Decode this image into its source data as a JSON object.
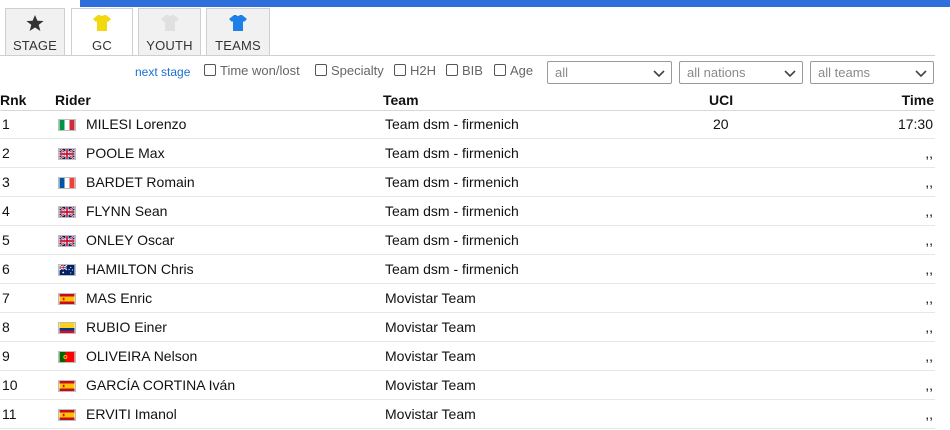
{
  "tabs": [
    {
      "label": "STAGE",
      "icon": "star-icon",
      "active": false
    },
    {
      "label": "GC",
      "icon": "yellow-jersey-icon",
      "active": true
    },
    {
      "label": "YOUTH",
      "icon": "white-jersey-icon",
      "active": false
    },
    {
      "label": "TEAMS",
      "icon": "blue-jersey-icon",
      "active": false
    }
  ],
  "colors": {
    "accent_bar": "#2f6fdc",
    "link": "#1a6fd1",
    "yellow_jersey": "#f2d80f",
    "white_jersey": "#e0e0e0",
    "blue_jersey": "#1f7fe8"
  },
  "filters": {
    "next_stage_label": "next stage",
    "checkboxes": [
      "Time won/lost",
      "Specialty",
      "H2H",
      "BIB",
      "Age"
    ],
    "selects": [
      {
        "value": "all"
      },
      {
        "value": "all nations"
      },
      {
        "value": "all teams"
      }
    ]
  },
  "table": {
    "headers": {
      "rnk": "Rnk",
      "rider": "Rider",
      "team": "Team",
      "uci": "UCI",
      "time": "Time"
    },
    "rows": [
      {
        "rnk": "1",
        "flag": "it",
        "rider": "MILESI Lorenzo",
        "team": "Team dsm - firmenich",
        "uci": "20",
        "time": "17:30"
      },
      {
        "rnk": "2",
        "flag": "gb",
        "rider": "POOLE Max",
        "team": "Team dsm - firmenich",
        "uci": "",
        "time": ",,"
      },
      {
        "rnk": "3",
        "flag": "fr",
        "rider": "BARDET Romain",
        "team": "Team dsm - firmenich",
        "uci": "",
        "time": ",,"
      },
      {
        "rnk": "4",
        "flag": "gb",
        "rider": "FLYNN Sean",
        "team": "Team dsm - firmenich",
        "uci": "",
        "time": ",,"
      },
      {
        "rnk": "5",
        "flag": "gb",
        "rider": "ONLEY Oscar",
        "team": "Team dsm - firmenich",
        "uci": "",
        "time": ",,"
      },
      {
        "rnk": "6",
        "flag": "au",
        "rider": "HAMILTON Chris",
        "team": "Team dsm - firmenich",
        "uci": "",
        "time": ",,"
      },
      {
        "rnk": "7",
        "flag": "es",
        "rider": "MAS Enric",
        "team": "Movistar Team",
        "uci": "",
        "time": ",,"
      },
      {
        "rnk": "8",
        "flag": "co",
        "rider": "RUBIO Einer",
        "team": "Movistar Team",
        "uci": "",
        "time": ",,"
      },
      {
        "rnk": "9",
        "flag": "pt",
        "rider": "OLIVEIRA Nelson",
        "team": "Movistar Team",
        "uci": "",
        "time": ",,"
      },
      {
        "rnk": "10",
        "flag": "es",
        "rider": "GARCÍA CORTINA Iván",
        "team": "Movistar Team",
        "uci": "",
        "time": ",,"
      },
      {
        "rnk": "11",
        "flag": "es",
        "rider": "ERVITI Imanol",
        "team": "Movistar Team",
        "uci": "",
        "time": ",,"
      }
    ]
  }
}
